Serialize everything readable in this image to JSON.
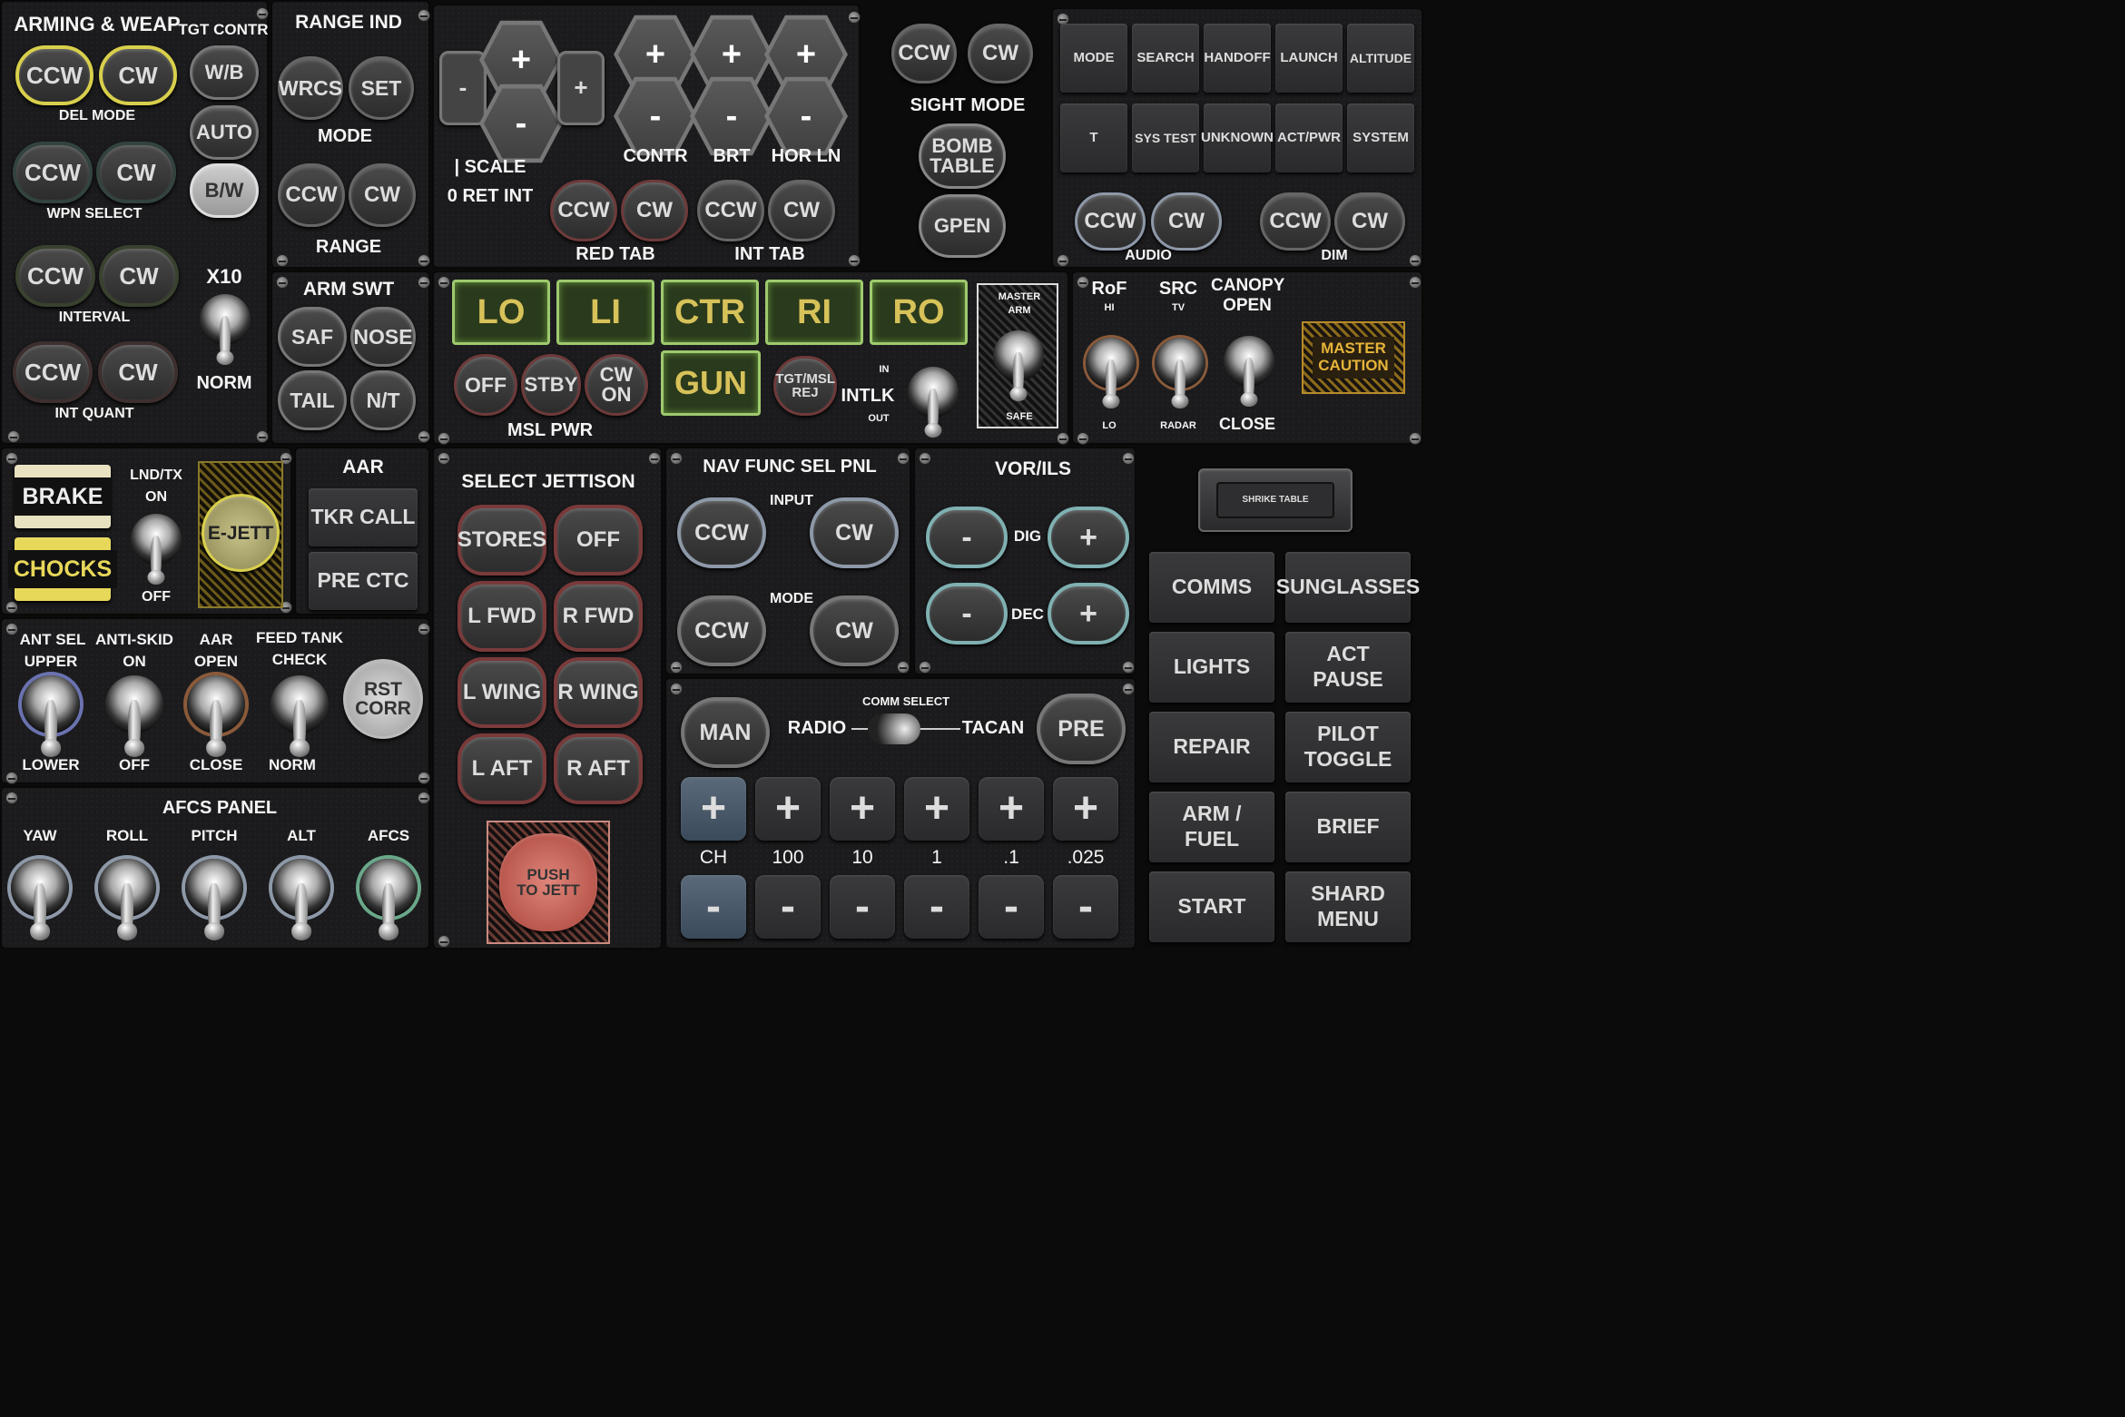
{
  "arming": {
    "title": "ARMING & WEAP",
    "tgt_contr": "TGT CONTR",
    "del_mode": "DEL MODE",
    "wpn_select": "WPN SELECT",
    "interval": "INTERVAL",
    "int_quant": "INT QUANT",
    "ccw": "CCW",
    "cw": "CW",
    "wb": "W/B",
    "auto": "AUTO",
    "bw": "B/W",
    "x10": "X10",
    "norm": "NORM"
  },
  "range": {
    "title": "RANGE IND",
    "wrcs": "WRCS",
    "set": "SET",
    "mode": "MODE",
    "ccw": "CCW",
    "cw": "CW",
    "range": "RANGE"
  },
  "sight": {
    "minus": "-",
    "plus": "+",
    "scale": "| SCALE",
    "ret_int": "0 RET INT",
    "contr": "CONTR",
    "brt": "BRT",
    "hor_ln": "HOR LN",
    "red_tab": "RED TAB",
    "int_tab": "INT TAB",
    "ccw": "CCW",
    "cw": "CW",
    "hex_plus": "+",
    "hex_minus": "-"
  },
  "sight_mode": {
    "ccw": "CCW",
    "cw": "CW",
    "title": "SIGHT MODE",
    "bomb_table": "BOMB TABLE",
    "gpen": "GPEN"
  },
  "radar": {
    "row1": [
      "MODE",
      "SEARCH",
      "HANDOFF",
      "LAUNCH",
      "ALTITUDE"
    ],
    "row2": [
      "T",
      "SYS TEST",
      "UNKNOWN",
      "ACT/PWR",
      "SYSTEM"
    ],
    "ccw": "CCW",
    "cw": "CW",
    "audio": "AUDIO",
    "dim": "DIM"
  },
  "arm_swt": {
    "title": "ARM SWT",
    "saf": "SAF",
    "nose": "NOSE",
    "tail": "TAIL",
    "nt": "N/T"
  },
  "stations": {
    "lamps": [
      "LO",
      "LI",
      "CTR",
      "RI",
      "RO"
    ],
    "gun": "GUN",
    "off": "OFF",
    "stby": "STBY",
    "cw_on": "CW ON",
    "msl_pwr": "MSL PWR",
    "tgt_msl_rej": "TGT/MSL REJ",
    "intlk": "INTLK",
    "in": "IN",
    "out": "OUT",
    "master_arm": "MASTER ARM",
    "safe": "SAFE"
  },
  "rof": {
    "rof": "RoF",
    "hi": "HI",
    "lo": "LO",
    "src": "SRC",
    "tv": "TV",
    "radar": "RADAR",
    "canopy": "CANOPY OPEN",
    "close": "CLOSE",
    "master_caution": "MASTER CAUTION"
  },
  "brake": {
    "brake": "BRAKE",
    "chocks": "CHOCKS",
    "lnd_tx": "LND/TX",
    "on": "ON",
    "off": "OFF",
    "ejett": "E-JETT"
  },
  "aar": {
    "title": "AAR",
    "tkr_call": "TKR CALL",
    "pre_ctc": "PRE CTC"
  },
  "misc": {
    "ant_sel": "ANT SEL",
    "upper": "UPPER",
    "lower": "LOWER",
    "anti_skid": "ANTI-SKID",
    "on": "ON",
    "off": "OFF",
    "aar": "AAR",
    "open": "OPEN",
    "close": "CLOSE",
    "feed_tank": "FEED TANK",
    "check": "CHECK",
    "norm": "NORM",
    "rst_corr": "RST CORR"
  },
  "afcs": {
    "title": "AFCS PANEL",
    "items": [
      "YAW",
      "ROLL",
      "PITCH",
      "ALT",
      "AFCS"
    ]
  },
  "jettison": {
    "title": "SELECT JETTISON",
    "buttons": [
      "STORES",
      "OFF",
      "L FWD",
      "R FWD",
      "L WING",
      "R WING",
      "L AFT",
      "R AFT"
    ],
    "push": "PUSH TO JETT"
  },
  "nav": {
    "title": "NAV FUNC SEL PNL",
    "input": "INPUT",
    "mode": "MODE",
    "ccw": "CCW",
    "cw": "CW"
  },
  "vor": {
    "title": "VOR/ILS",
    "dig": "DIG",
    "dec": "DEC",
    "minus": "-",
    "plus": "+"
  },
  "comm": {
    "man": "MAN",
    "radio": "RADIO",
    "comm_select": "COMM SELECT",
    "tacan": "TACAN",
    "pre": "PRE",
    "labels": [
      "CH",
      "100",
      "10",
      "1",
      ".1",
      ".025"
    ],
    "plus": "+",
    "minus": "-"
  },
  "menu": {
    "shrike": "SHRIKE TABLE",
    "buttons": [
      "COMMS",
      "SUNGLASSES",
      "LIGHTS",
      "ACT PAUSE",
      "REPAIR",
      "PILOT TOGGLE",
      "ARM / FUEL",
      "BRIEF",
      "START",
      "SHARD MENU"
    ]
  }
}
